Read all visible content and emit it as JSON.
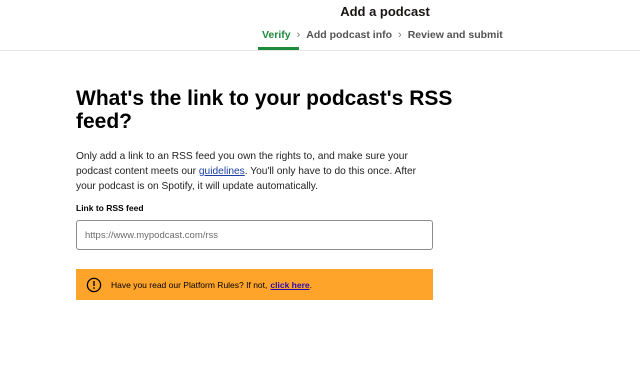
{
  "header": {
    "title": "Add a podcast",
    "steps": [
      {
        "label": "Verify",
        "active": true
      },
      {
        "label": "Add podcast info",
        "active": false
      },
      {
        "label": "Review and submit",
        "active": false
      }
    ]
  },
  "main": {
    "heading": "What's the link to your podcast's RSS feed?",
    "description": {
      "before_link": "Only add a link to an RSS feed you own the rights to, and make sure your podcast content meets our ",
      "link": "guidelines",
      "after_link": ". You'll only have to do this once. After your podcast is on Spotify, it will update automatically."
    },
    "rss_field": {
      "label": "Link to RSS feed",
      "value": "",
      "placeholder": "https://www.mypodcast.com/rss"
    },
    "notice": {
      "text": "Have you read our Platform Rules? If not,",
      "link": "click here",
      "suffix": ".",
      "icon": "warning-circle-icon"
    }
  },
  "colors": {
    "active_step": "#1e8a3c",
    "notice_bg": "#ffa42b",
    "link": "#1b3fa0"
  }
}
